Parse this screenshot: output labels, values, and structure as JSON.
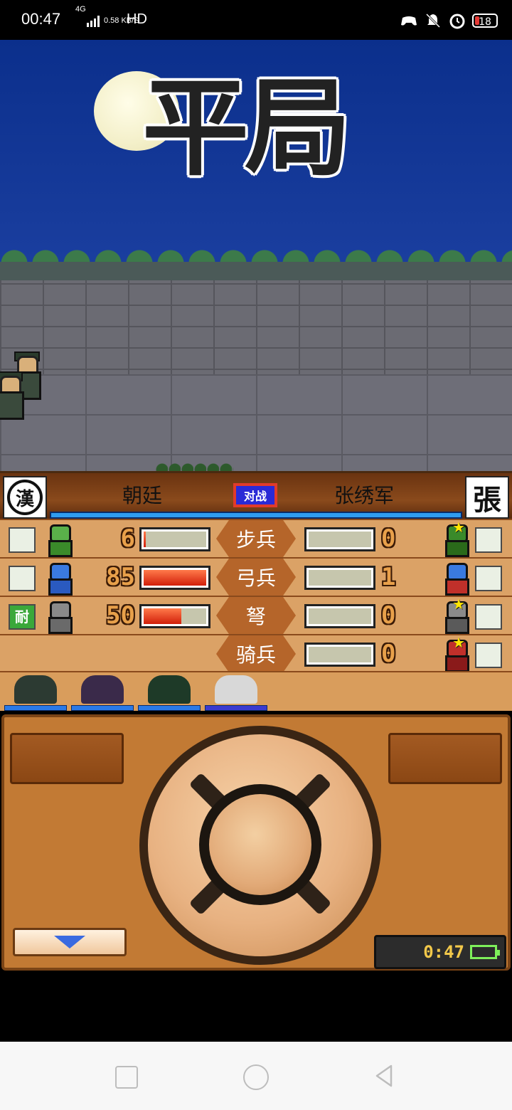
{
  "status_bar": {
    "time": "00:47",
    "network": "4G",
    "speed": "0.58 KB/S",
    "hd": "HD",
    "battery": "18",
    "icons": [
      "game-controller-icon",
      "mute-bell-icon",
      "alarm-icon",
      "battery-icon"
    ]
  },
  "scene": {
    "result_title": "平局"
  },
  "battle_panel": {
    "left_army": "朝廷",
    "right_army": "张绣军",
    "vs_badge": "对战",
    "right_emblem": "張",
    "rows": [
      {
        "label": "步兵",
        "left_count": "6",
        "left_fill": 0.03,
        "right_count": "0",
        "right_fill": 0,
        "has_left": true
      },
      {
        "label": "弓兵",
        "left_count": "85",
        "left_fill": 1.0,
        "right_count": "1",
        "right_fill": 0,
        "has_left": true
      },
      {
        "label": "弩",
        "left_count": "50",
        "left_fill": 0.6,
        "right_count": "0",
        "right_fill": 0,
        "has_left": true,
        "left_tag": "耐"
      },
      {
        "label": "骑兵",
        "left_count": "",
        "left_fill": 0,
        "right_count": "0",
        "right_fill": 0,
        "has_left": false
      }
    ]
  },
  "controls": {
    "clock": "0:47"
  },
  "nav_bar": {
    "buttons": [
      "recents-button",
      "home-button",
      "back-button"
    ]
  }
}
